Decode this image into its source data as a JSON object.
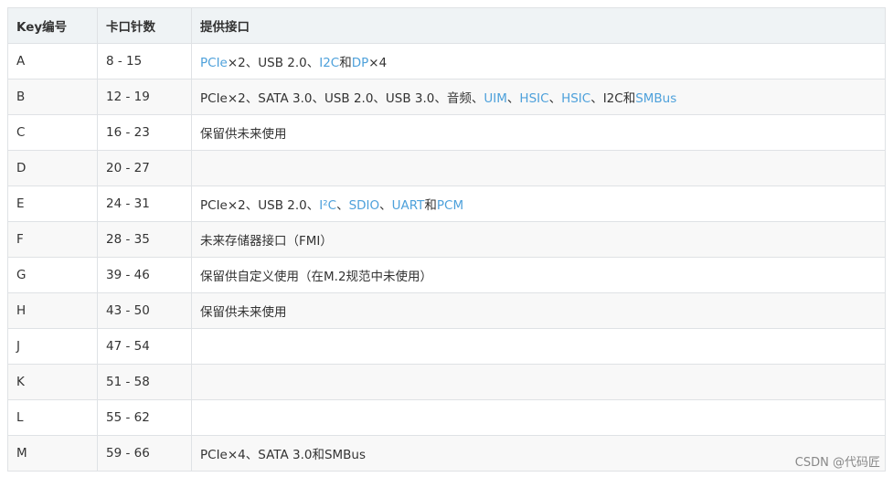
{
  "table": {
    "headers": [
      "Key编号",
      "卡口针数",
      "提供接口"
    ],
    "rows": [
      {
        "key": "A",
        "pins": "8 - 15",
        "iface": [
          {
            "t": "PCIe",
            "link": true
          },
          {
            "t": "×2、USB 2.0、"
          },
          {
            "t": "I2C",
            "link": true
          },
          {
            "t": "和"
          },
          {
            "t": "DP",
            "link": true
          },
          {
            "t": "×4"
          }
        ]
      },
      {
        "key": "B",
        "pins": "12 - 19",
        "iface": [
          {
            "t": "PCIe×2、SATA 3.0、USB 2.0、USB 3.0、音频、"
          },
          {
            "t": "UIM",
            "link": true
          },
          {
            "t": "、"
          },
          {
            "t": "HSIC",
            "link": true
          },
          {
            "t": "、"
          },
          {
            "t": "HSIC",
            "link": true
          },
          {
            "t": "、I2C和"
          },
          {
            "t": "SMBus",
            "link": true
          }
        ]
      },
      {
        "key": "C",
        "pins": "16 - 23",
        "iface": [
          {
            "t": "保留供未来使用"
          }
        ]
      },
      {
        "key": "D",
        "pins": "20 - 27",
        "iface": []
      },
      {
        "key": "E",
        "pins": "24 - 31",
        "iface": [
          {
            "t": "PCIe×2、USB 2.0、"
          },
          {
            "t": "I²C",
            "link": true
          },
          {
            "t": "、"
          },
          {
            "t": "SDIO",
            "link": true
          },
          {
            "t": "、"
          },
          {
            "t": "UART",
            "link": true
          },
          {
            "t": "和"
          },
          {
            "t": "PCM",
            "link": true
          }
        ]
      },
      {
        "key": "F",
        "pins": "28 - 35",
        "iface": [
          {
            "t": "未来存储器接口（FMI）"
          }
        ]
      },
      {
        "key": "G",
        "pins": "39 - 46",
        "iface": [
          {
            "t": "保留供自定义使用（在M.2规范中未使用）"
          }
        ]
      },
      {
        "key": "H",
        "pins": "43 - 50",
        "iface": [
          {
            "t": "保留供未来使用"
          }
        ]
      },
      {
        "key": "J",
        "pins": "47 - 54",
        "iface": []
      },
      {
        "key": "K",
        "pins": "51 - 58",
        "iface": []
      },
      {
        "key": "L",
        "pins": "55 - 62",
        "iface": []
      },
      {
        "key": "M",
        "pins": "59 - 66",
        "iface": [
          {
            "t": "PCIe×4、SATA 3.0和SMBus"
          }
        ]
      }
    ]
  },
  "watermark": "CSDN @代码匠",
  "colors": {
    "link": "#4ea1db",
    "header_bg": "#eff3f5",
    "stripe_bg": "#f8f8f8",
    "border": "#dfe2e5"
  }
}
